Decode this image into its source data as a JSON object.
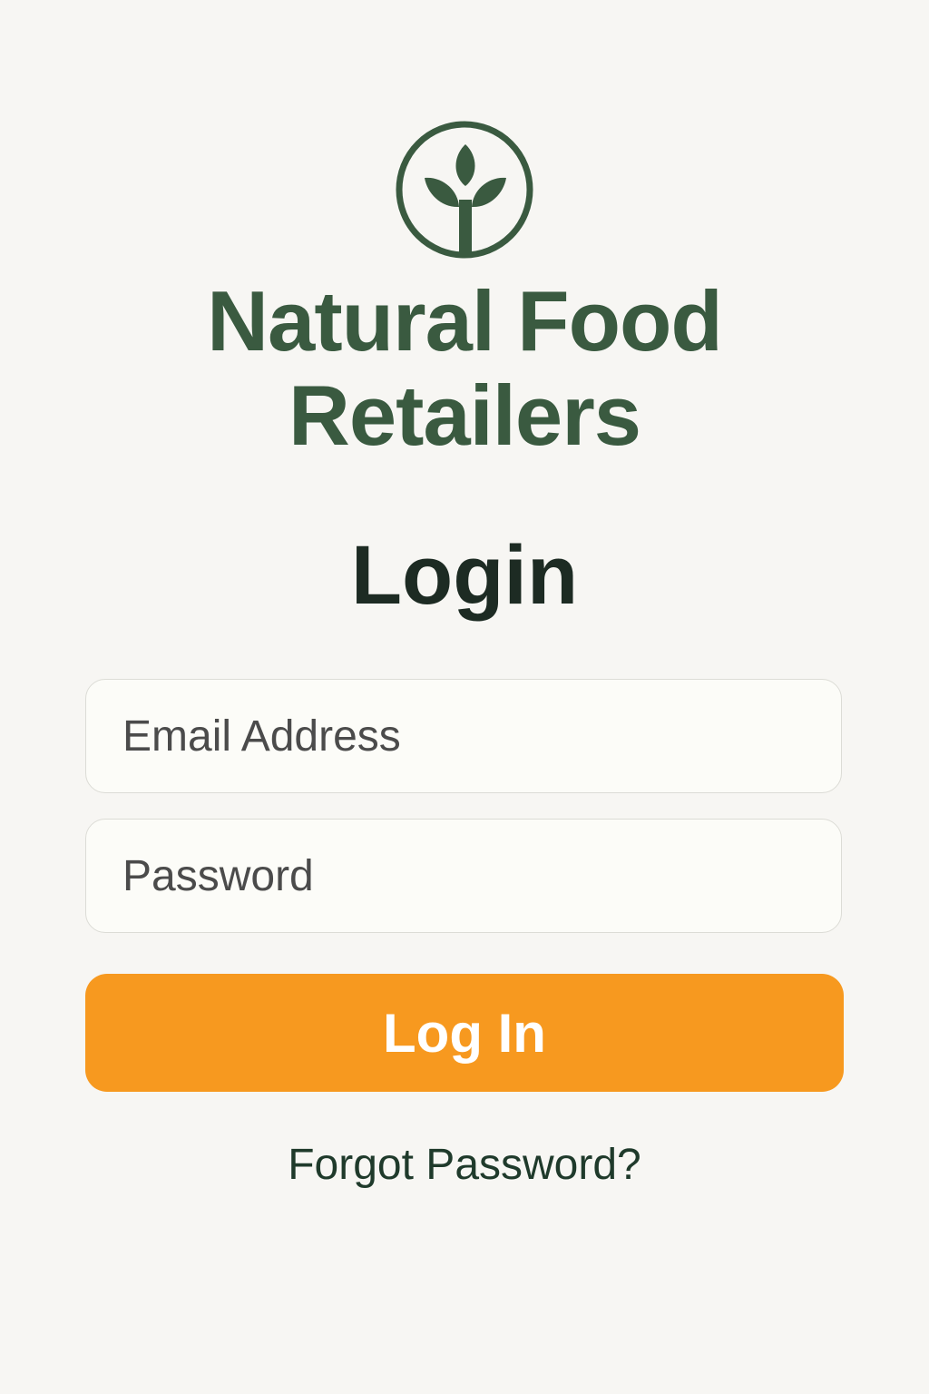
{
  "brand": {
    "logo_icon": "sprout-in-circle-icon",
    "name_line1": "Natural Food",
    "name_line2": "Retailers",
    "color": "#3a5a40"
  },
  "login": {
    "title": "Login",
    "email_placeholder": "Email Address",
    "password_placeholder": "Password",
    "submit_label": "Log In",
    "forgot_password_label": "Forgot Password?",
    "button_color": "#f7991f"
  }
}
